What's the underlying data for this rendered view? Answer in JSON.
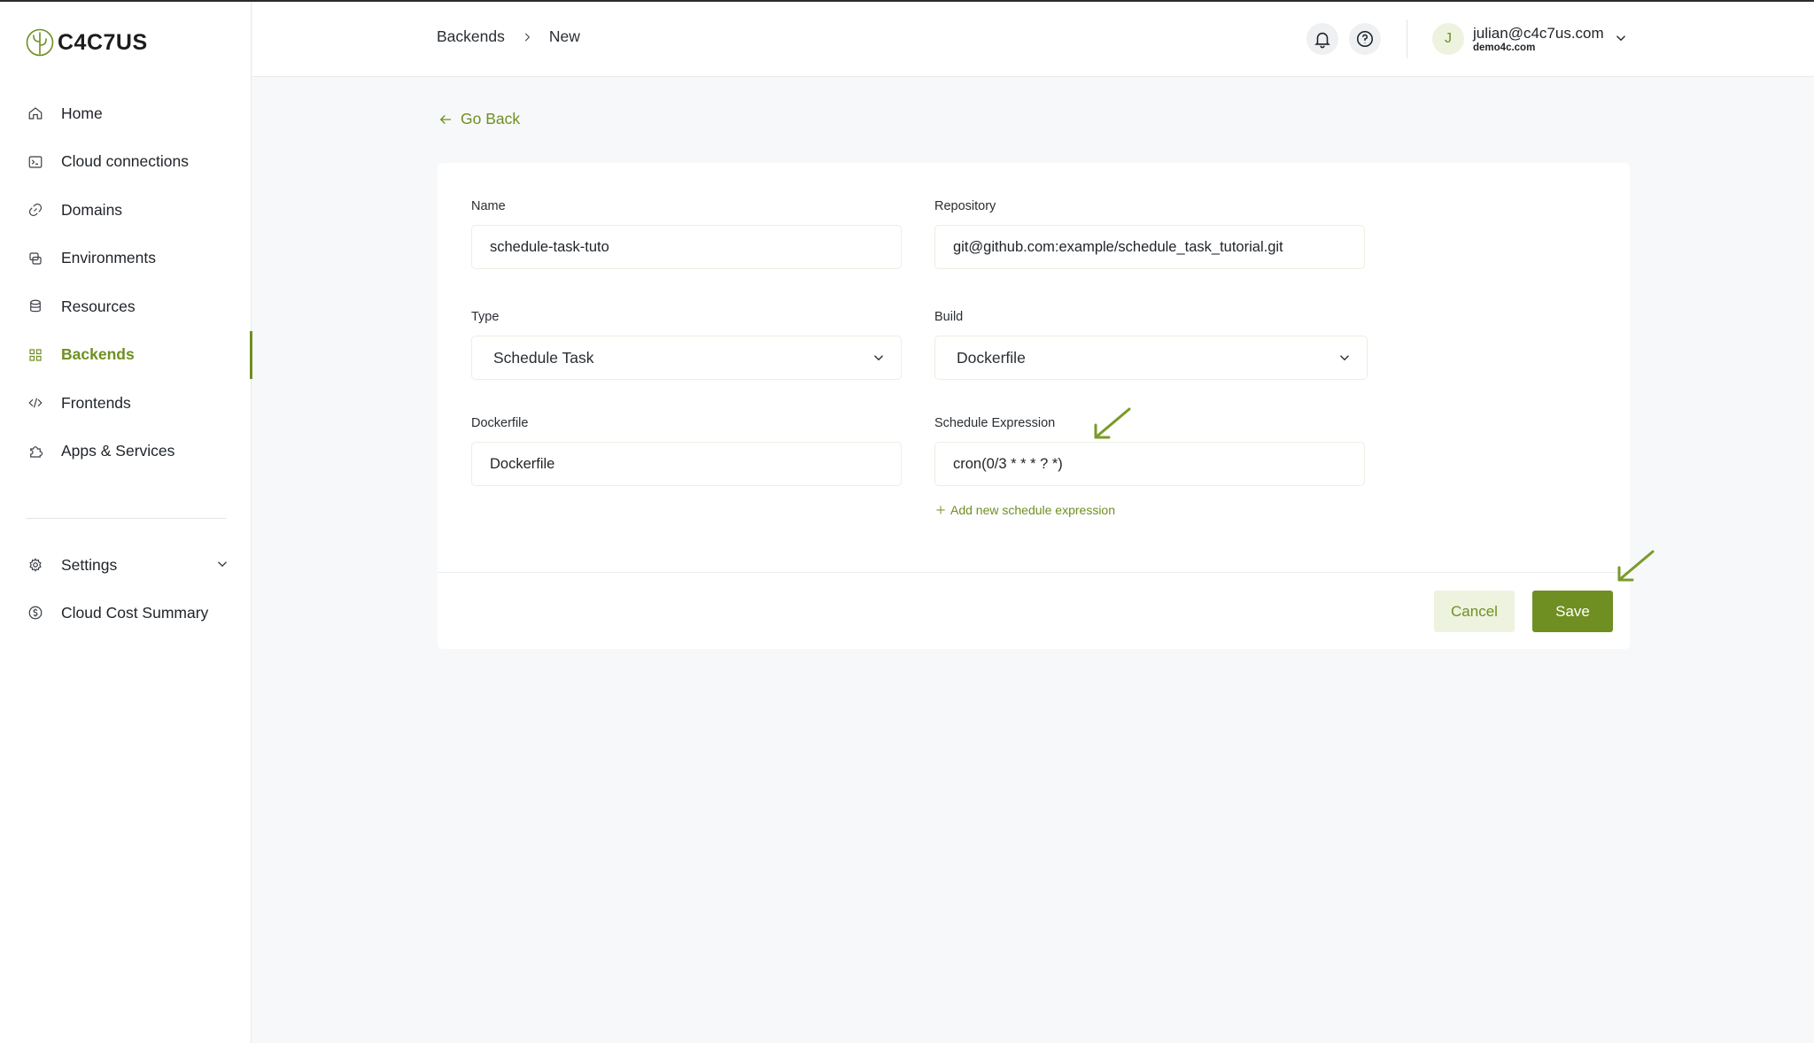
{
  "brand": {
    "name": "C4C7US",
    "accent": "#6f8f22"
  },
  "sidebar": {
    "items": [
      {
        "label": "Home",
        "icon": "home-icon"
      },
      {
        "label": "Cloud connections",
        "icon": "terminal-icon"
      },
      {
        "label": "Domains",
        "icon": "link-icon"
      },
      {
        "label": "Environments",
        "icon": "environments-icon"
      },
      {
        "label": "Resources",
        "icon": "database-icon"
      },
      {
        "label": "Backends",
        "icon": "grid-icon",
        "active": true
      },
      {
        "label": "Frontends",
        "icon": "code-icon"
      },
      {
        "label": "Apps & Services",
        "icon": "puzzle-icon"
      }
    ],
    "secondary": [
      {
        "label": "Settings",
        "icon": "gear-icon"
      },
      {
        "label": "Cloud Cost Summary",
        "icon": "dollar-circle-icon"
      }
    ]
  },
  "header": {
    "breadcrumb": [
      "Backends",
      "New"
    ],
    "user": {
      "initial": "J",
      "email": "julian@c4c7us.com",
      "org": "demo4c.com"
    }
  },
  "page": {
    "go_back": "Go Back",
    "form": {
      "name": {
        "label": "Name",
        "value": "schedule-task-tuto"
      },
      "repository": {
        "label": "Repository",
        "value": "git@github.com:example/schedule_task_tutorial.git"
      },
      "type": {
        "label": "Type",
        "value": "Schedule Task"
      },
      "build": {
        "label": "Build",
        "value": "Dockerfile"
      },
      "dockerfile": {
        "label": "Dockerfile",
        "value": "Dockerfile"
      },
      "schedule": {
        "label": "Schedule Expression",
        "value": "cron(0/3 * * * ? *)"
      },
      "add_schedule": "Add new schedule expression"
    },
    "actions": {
      "cancel": "Cancel",
      "save": "Save"
    }
  }
}
